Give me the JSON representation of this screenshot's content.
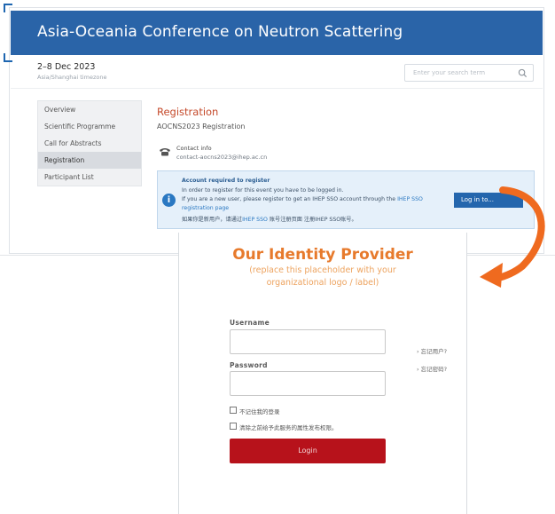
{
  "event": {
    "title": "Asia-Oceania Conference on Neutron Scattering",
    "date": "2–8 Dec 2023",
    "timezone": "Asia/Shanghai timezone",
    "search_placeholder": "Enter your search term",
    "sidebar": [
      "Overview",
      "Scientific Programme",
      "Call for Abstracts",
      "Registration",
      "Participant List"
    ],
    "active_item": "Registration",
    "page_title": "Registration",
    "page_subtitle": "AOCNS2023 Registration",
    "contact_label": "Contact info",
    "contact_email": "contact-aocns2023@ihep.ac.cn",
    "notice": {
      "heading": "Account required to register",
      "line1": "In order to register for this event you have to be logged in.",
      "line2_prefix": "If you are a new user, please register to get an IHEP SSO account through the ",
      "line2_link": "IHEP SSO",
      "line3": "registration page",
      "line4_prefix": "如果你是新用户，请通过",
      "line4_link": "IHEP SSO",
      "line4_suffix": " 账号注册页面 注册IHEP SSO账号。",
      "login_label": "Log in to..."
    }
  },
  "idp": {
    "title": "Our Identity Provider",
    "note_line1": "(replace this placeholder with your",
    "note_line2": "organizational logo / label)",
    "username_label": "Username",
    "password_label": "Password",
    "forgot_username": "› 忘记用户?",
    "forgot_password": "› 忘记密码?",
    "remember_label": "不记住我的登录",
    "consent_label": "清除之前给予此服务的属性发布权限。",
    "login_label": "Login"
  },
  "colors": {
    "banner": "#2a64a8",
    "accent_red": "#c54a2b",
    "idp_orange": "#e77a2c",
    "login_red": "#b7121b",
    "arrow": "#ef6a1f"
  },
  "icons": [
    "search-icon",
    "phone-icon",
    "info-icon",
    "curved-arrow-icon"
  ]
}
